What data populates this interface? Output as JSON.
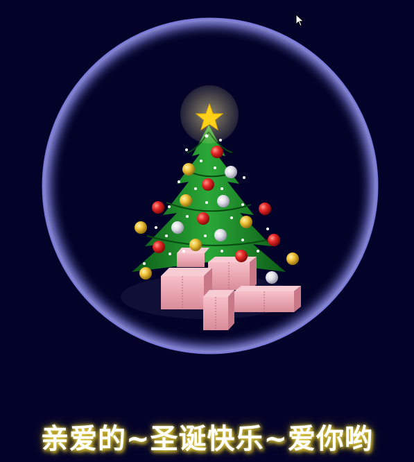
{
  "greeting": {
    "text": "亲爱的~圣诞快乐~爱你哟"
  },
  "icons": {
    "cursor": "mouse-pointer-icon",
    "star": "star-icon"
  },
  "colors": {
    "background": "#03032a",
    "globe_ring": "#7a7ad8",
    "tree": "#1c8a2a",
    "star": "#ffd21a",
    "gift": "#f2a8b4",
    "ornament_red": "#e82a2a",
    "ornament_gold": "#f0c43a",
    "ornament_white": "#e8e8ee"
  }
}
